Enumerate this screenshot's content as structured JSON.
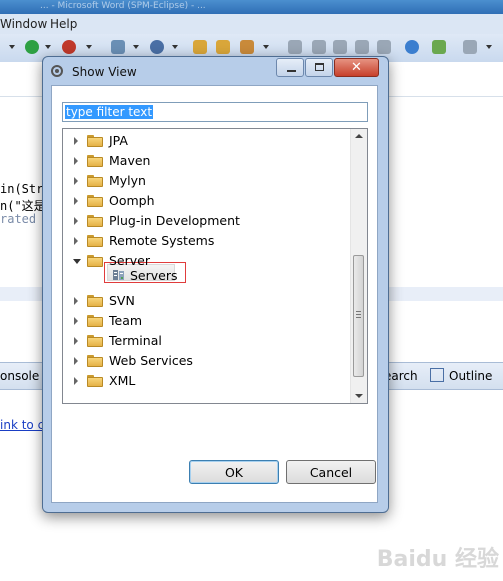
{
  "background": {
    "title_text": "... - Microsoft Word (SPM-Eclipse) - ...",
    "menu": [
      {
        "label": "Window"
      },
      {
        "label": "Help"
      }
    ],
    "code": [
      {
        "text": "in(Str"
      },
      {
        "text": "n(\"这是"
      },
      {
        "text": "rated m"
      }
    ],
    "bottom_tabs": {
      "console": "onsole",
      "search": "earch",
      "outline": "Outline"
    },
    "link_text": "ink to c",
    "watermark": "Baidu 经验"
  },
  "dialog": {
    "title": "Show View",
    "filter_value": "type filter text",
    "tree": [
      {
        "label": "JPA",
        "expanded": false
      },
      {
        "label": "Maven",
        "expanded": false
      },
      {
        "label": "Mylyn",
        "expanded": false
      },
      {
        "label": "Oomph",
        "expanded": false
      },
      {
        "label": "Plug-in Development",
        "expanded": false
      },
      {
        "label": "Remote Systems",
        "expanded": false
      },
      {
        "label": "Server",
        "expanded": true
      },
      {
        "label": "SVN",
        "expanded": false
      },
      {
        "label": "Team",
        "expanded": false
      },
      {
        "label": "Terminal",
        "expanded": false
      },
      {
        "label": "Web Services",
        "expanded": false
      },
      {
        "label": "XML",
        "expanded": false
      }
    ],
    "selected_child": {
      "label": "Servers",
      "parent": "Server",
      "icon": "servers-icon"
    },
    "buttons": {
      "ok": "OK",
      "cancel": "Cancel"
    }
  },
  "colors": {
    "selection": "#3399ff",
    "highlight_border": "#e03c3c",
    "dialog_frame": "#b7cde9"
  }
}
